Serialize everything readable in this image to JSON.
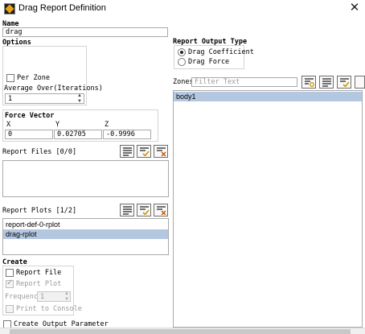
{
  "window": {
    "title": "Drag Report Definition",
    "close_glyph": "✕"
  },
  "name": {
    "label": "Name",
    "value": "drag"
  },
  "options": {
    "label": "Options",
    "per_zone_label": "Per Zone",
    "per_zone_checked": false,
    "average_over_label": "Average Over(Iterations)",
    "average_over_value": "1"
  },
  "force_vector": {
    "label": "Force Vector",
    "x_label": "X",
    "y_label": "Y",
    "z_label": "Z",
    "x_value": "0",
    "y_value": "0.02705",
    "z_value": "-0.9996"
  },
  "report_files": {
    "label": "Report Files [0/0]",
    "items": []
  },
  "report_plots": {
    "label": "Report Plots [1/2]",
    "items": [
      {
        "label": "report-def-0-rplot",
        "selected": false
      },
      {
        "label": "drag-rplot",
        "selected": true
      }
    ]
  },
  "create": {
    "label": "Create",
    "report_file_label": "Report File",
    "report_plot_label": "Report Plot",
    "frequency_label": "Frequency",
    "frequency_value": "1",
    "print_to_console_label": "Print to Console",
    "create_output_parameter_label": "Create Output Parameter"
  },
  "report_output_type": {
    "label": "Report Output Type",
    "options": [
      "Drag Coefficient",
      "Drag Force"
    ],
    "selected": "Drag Coefficient"
  },
  "zones": {
    "label": "Zones",
    "filter_placeholder": "Filter Text",
    "items": [
      {
        "label": "body1",
        "selected": true
      }
    ]
  }
}
